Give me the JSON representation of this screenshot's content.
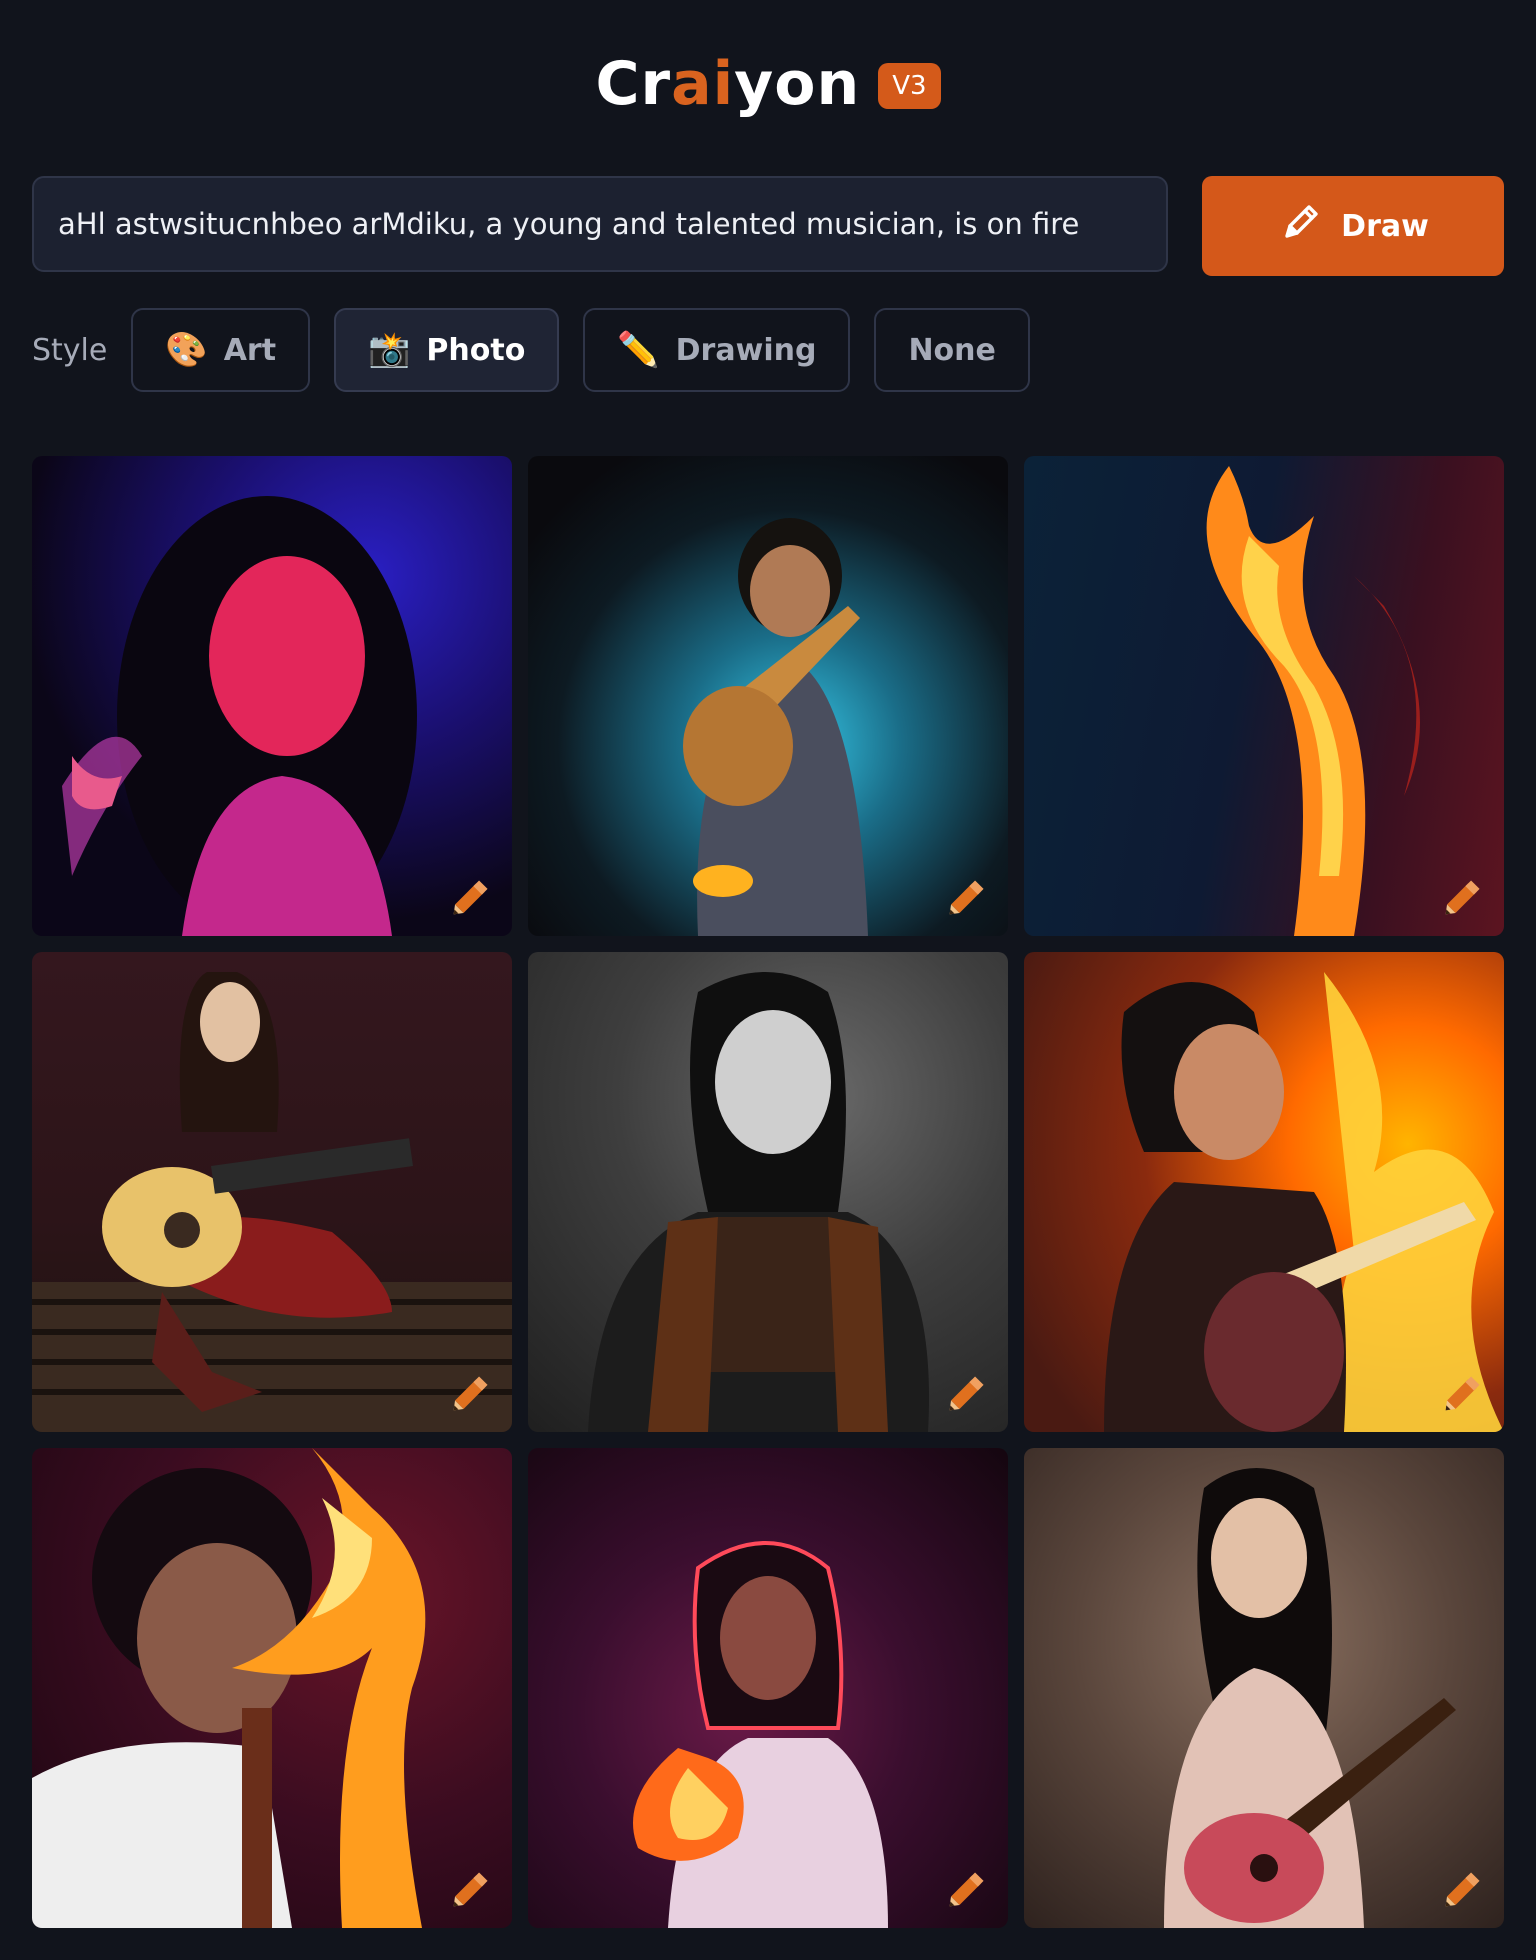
{
  "header": {
    "logo_prefix": "Cr",
    "logo_accent": "ai",
    "logo_suffix": "yon",
    "version_badge": "V3"
  },
  "prompt": {
    "value": "aHl astwsitucnhbeo arMdiku, a young and talented musician, is on fire"
  },
  "draw_button": {
    "label": "Draw",
    "icon": "pencil-icon"
  },
  "style": {
    "label": "Style",
    "options": [
      {
        "label": "Art",
        "icon": "🎨",
        "selected": false
      },
      {
        "label": "Photo",
        "icon": "📸",
        "selected": true
      },
      {
        "label": "Drawing",
        "icon": "✏️",
        "selected": false
      },
      {
        "label": "None",
        "icon": "",
        "selected": false
      }
    ]
  },
  "results": {
    "tiles": [
      {
        "icon": "pencil-edit-icon"
      },
      {
        "icon": "pencil-edit-icon"
      },
      {
        "icon": "pencil-edit-icon"
      },
      {
        "icon": "pencil-edit-icon"
      },
      {
        "icon": "pencil-edit-icon"
      },
      {
        "icon": "pencil-edit-icon"
      },
      {
        "icon": "pencil-edit-icon"
      },
      {
        "icon": "pencil-edit-icon"
      },
      {
        "icon": "pencil-edit-icon"
      }
    ]
  },
  "colors": {
    "background": "#11141c",
    "accent": "#d4581a",
    "input_bg": "#1c2130",
    "border": "#2f3548"
  }
}
